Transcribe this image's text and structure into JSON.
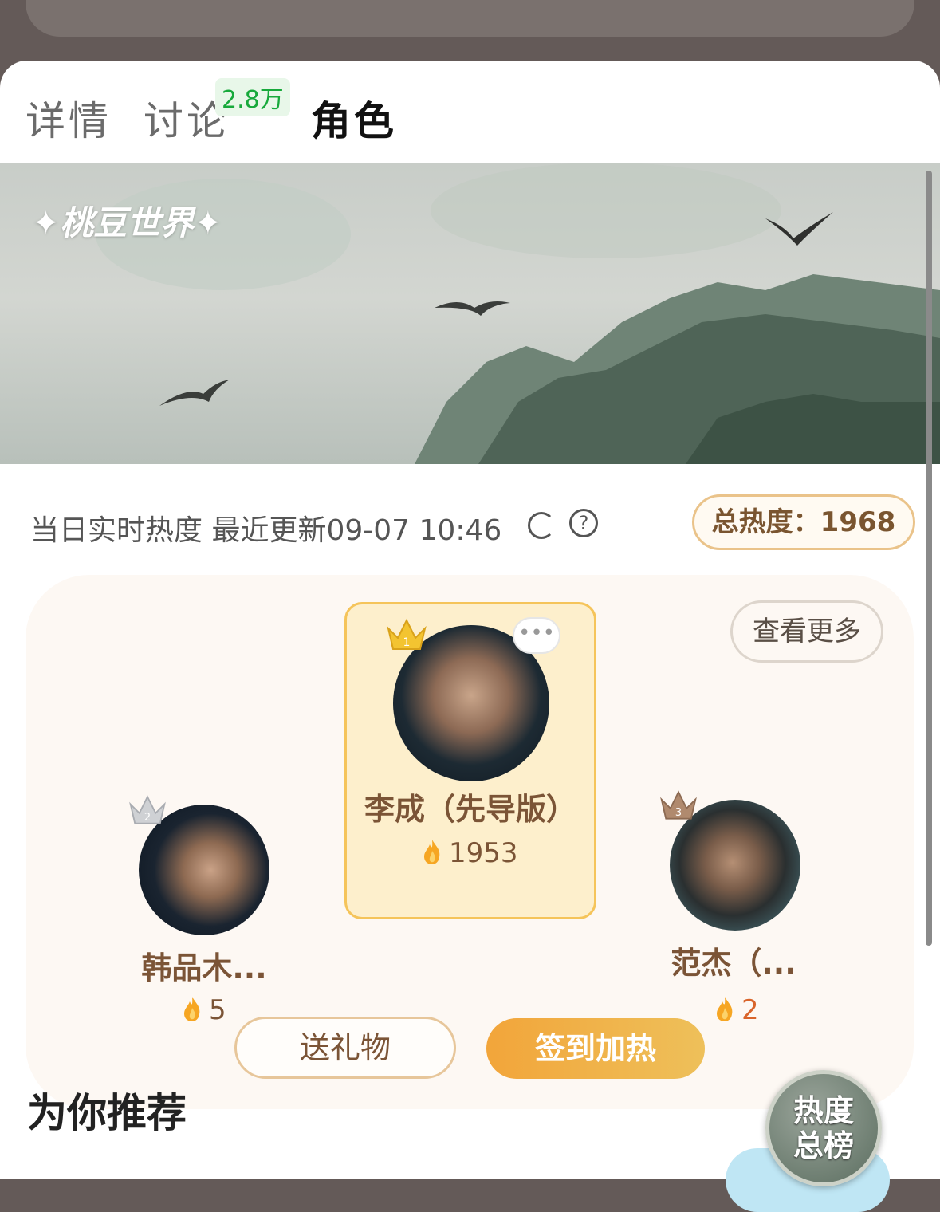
{
  "tabs": [
    {
      "label": "详情"
    },
    {
      "label": "讨论",
      "badge": "2.8万"
    },
    {
      "label": "角色"
    }
  ],
  "banner": {
    "logo_text": "✦桃豆世界✦"
  },
  "heat": {
    "label": "当日实时热度 最近更新09-07 10:46",
    "total_label": "总热度：1968"
  },
  "ranking": {
    "more_label": "查看更多",
    "first": {
      "name": "李成（先导版）",
      "score": "1953",
      "rank": "1"
    },
    "second": {
      "name": "韩品木...",
      "score": "5",
      "rank": "2"
    },
    "third": {
      "name": "范杰（...",
      "score": "2",
      "rank": "3"
    }
  },
  "actions": {
    "gift_label": "送礼物",
    "checkin_label": "签到加热"
  },
  "recommend": {
    "title": "为你推荐"
  },
  "float_badge": {
    "line1": "热度",
    "line2": "总榜"
  },
  "colors": {
    "accent_orange": "#f2a53a",
    "brown_text": "#7b5436",
    "badge_green": "#17a93b"
  }
}
